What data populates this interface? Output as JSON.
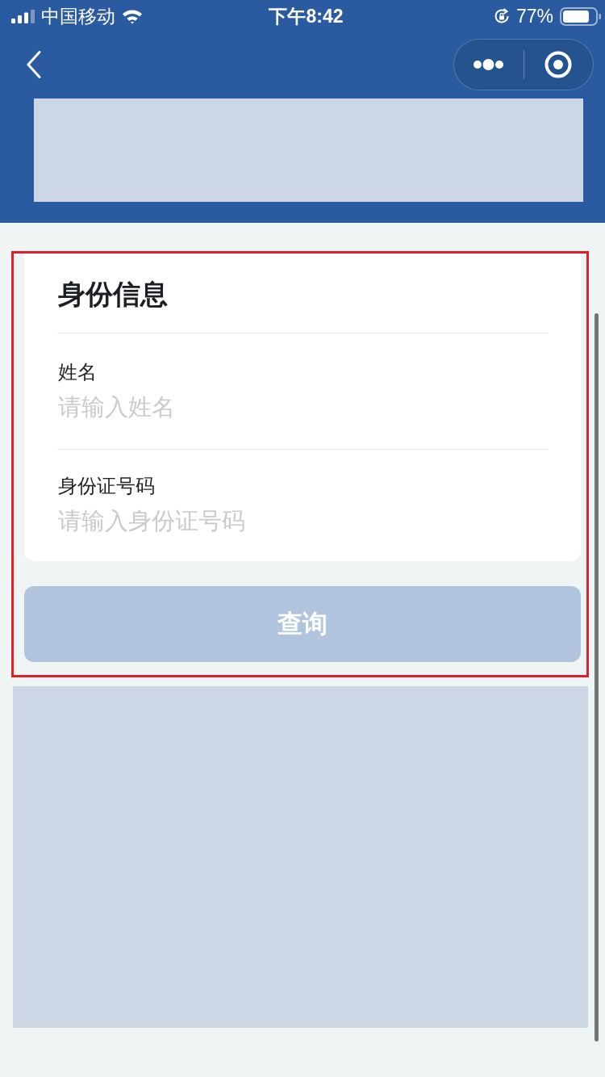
{
  "status_bar": {
    "carrier": "中国移动",
    "time": "下午8:42",
    "battery": "77%"
  },
  "form": {
    "title": "身份信息",
    "fields": [
      {
        "label": "姓名",
        "placeholder": "请输入姓名"
      },
      {
        "label": "身份证号码",
        "placeholder": "请输入身份证号码"
      }
    ]
  },
  "submit_button": {
    "label": "查询",
    "disabled": true
  }
}
